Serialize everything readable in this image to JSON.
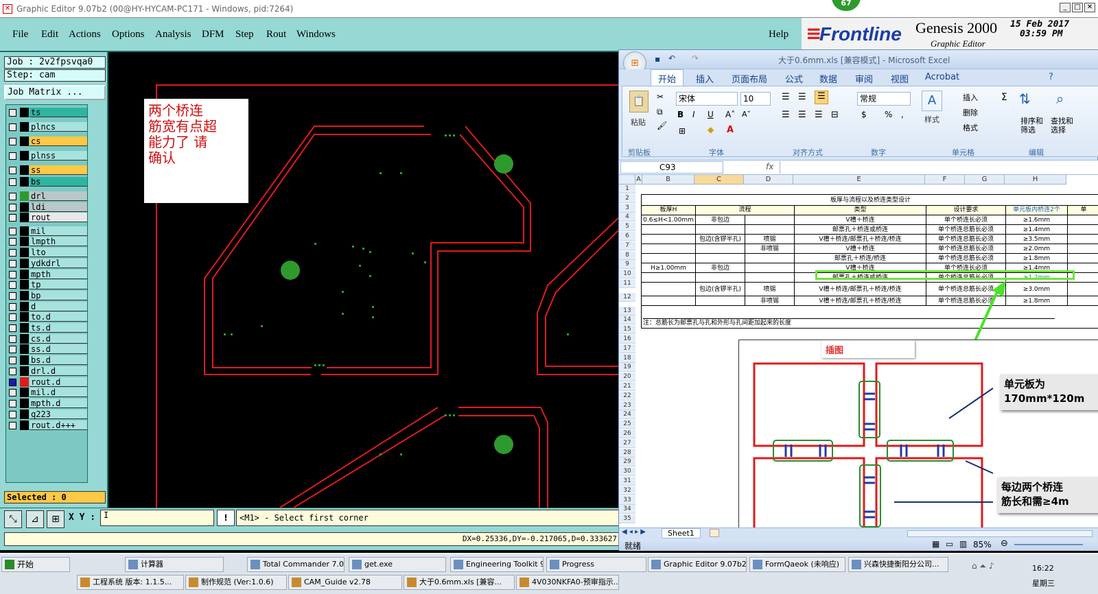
{
  "genesis": {
    "window_title": "Graphic Editor 9.07b2 (00@HY-HYCAM-PC171 - Windows, pid:7264)",
    "menu": [
      "File",
      "Edit",
      "Actions",
      "Options",
      "Analysis",
      "DFM",
      "Step",
      "Rout",
      "Windows"
    ],
    "help": "Help",
    "badge": "67",
    "brand": {
      "logo": "Frontline",
      "product": "Genesis 2000",
      "subtitle": "Graphic Editor",
      "date": "15 Feb 2017",
      "time": "03:59 PM"
    },
    "job_label": "Job : 2v2fpsvqa0",
    "step_label": "Step: cam",
    "job_matrix": "Job Matrix ...",
    "layers": [
      {
        "name": "ts",
        "color": "#2fb4a2"
      },
      {
        "name": "plncs",
        "color": "#a8e2de"
      },
      {
        "name": "cs",
        "color": "#ffc845"
      },
      {
        "name": "plnss",
        "color": "#a8e2de"
      },
      {
        "name": "ss",
        "color": "#ffc845"
      },
      {
        "name": "bs",
        "color": "#2fb4a2"
      },
      {
        "name": "drl",
        "color": "#b8c8c8"
      },
      {
        "name": "ldi",
        "color": "#b8c8c8"
      },
      {
        "name": "rout",
        "color": "#e8e8e8"
      },
      {
        "name": "mil",
        "color": "#a8e2de"
      },
      {
        "name": "lmpth",
        "color": "#a8e2de"
      },
      {
        "name": "lto",
        "color": "#a8e2de"
      },
      {
        "name": "ydkdrl",
        "color": "#a8e2de"
      },
      {
        "name": "mpth",
        "color": "#a8e2de"
      },
      {
        "name": "tp",
        "color": "#a8e2de"
      },
      {
        "name": "bp",
        "color": "#a8e2de"
      },
      {
        "name": "d",
        "color": "#a8e2de"
      },
      {
        "name": "to.d",
        "color": "#a8e2de"
      },
      {
        "name": "ts.d",
        "color": "#a8e2de"
      },
      {
        "name": "cs.d",
        "color": "#a8e2de"
      },
      {
        "name": "ss.d",
        "color": "#a8e2de"
      },
      {
        "name": "bs.d",
        "color": "#a8e2de"
      },
      {
        "name": "drl.d",
        "color": "#a8e2de"
      },
      {
        "name": "rout.d",
        "color": "#a8e2de"
      },
      {
        "name": "mil.d",
        "color": "#a8e2de"
      },
      {
        "name": "mpth.d",
        "color": "#a8e2de"
      },
      {
        "name": "q223",
        "color": "#a8e2de"
      },
      {
        "name": "rout.d+++",
        "color": "#a8e2de"
      }
    ],
    "selected": "Selected : 0",
    "xy_label": "X Y :",
    "prompt": "<M1> - Select first corner",
    "coords": "DX=0.25336,DY=-0.217065,D=0.333627",
    "note": [
      "两个桥连",
      "筋宽有点超",
      "能力了  请",
      "确认"
    ]
  },
  "excel": {
    "title": "大于0.6mm.xls [兼容模式] - Microsoft Excel",
    "tabs": [
      "开始",
      "插入",
      "页面布局",
      "公式",
      "数据",
      "审阅",
      "视图",
      "Acrobat"
    ],
    "ribbon": {
      "paste": "粘贴",
      "font_name": "宋体",
      "font_size": "10",
      "number_format": "常规",
      "styles": "样式",
      "insert": "插入",
      "delete": "删除",
      "format": "格式",
      "sort_filter": "排序和\n筛选",
      "find_select": "查找和\n选择",
      "groups": [
        "剪贴板",
        "字体",
        "对齐方式",
        "数字",
        "单元格",
        "编辑"
      ]
    },
    "name_box": "C93",
    "fx": "fx",
    "columns": [
      "A",
      "B",
      "C",
      "D",
      "E",
      "F",
      "G",
      "H"
    ],
    "table_title": "板厚与流程以及桥连类型设计",
    "headers": [
      "板厚H",
      "流程",
      "类型",
      "设计要求",
      "单元板内桥连2个",
      "单"
    ],
    "rows": [
      [
        "0.6≤H<1.00mm",
        "非包边",
        "",
        "V槽＋桥连",
        "单个桥连长必须",
        "≥1.6mm"
      ],
      [
        "",
        "",
        "",
        "邮票孔＋桥连或桥连",
        "单个桥连总筋长必须",
        "≥1.4mm"
      ],
      [
        "",
        "包边(含锣半孔)",
        "喷锡",
        "V槽＋桥连/邮票孔＋桥连/桥连",
        "单个桥连总筋长必须",
        "≥3.5mm"
      ],
      [
        "",
        "",
        "非喷锡",
        "V槽＋桥连",
        "单个桥连总筋长必须",
        "≥2.0mm"
      ],
      [
        "",
        "",
        "",
        "邮票孔＋桥连/桥连",
        "单个桥连总筋长必须",
        "≥1.8mm"
      ],
      [
        "H≥1.00mm",
        "非包边",
        "",
        "V槽＋桥连",
        "单个桥连长必须",
        "≥1.4mm"
      ],
      [
        "",
        "",
        "",
        "邮票孔＋桥连或桥连",
        "单个桥连总筋长必须",
        "≥1.2mm"
      ],
      [
        "",
        "包边(含锣半孔)",
        "喷锡",
        "V槽＋桥连/邮票孔＋桥连/桥连",
        "单个桥连总筋长必须",
        "≥3.0mm"
      ],
      [
        "",
        "",
        "非喷锡",
        "V槽＋桥连/邮票孔＋桥连/桥连",
        "单个桥连总筋长必须",
        "≥1.8mm"
      ]
    ],
    "footnote": "注：总筋长为邮票孔与孔和外形与孔间距加起来的长度",
    "insert_label": "插图",
    "callout1": "单元板为\n170mm*120m",
    "callout2": "每边两个桥连\n筋长和需≥4m",
    "sheet_tab": "Sheet1",
    "status": "就绪",
    "zoom": "85%"
  },
  "taskbar": {
    "start": "开始",
    "row1": [
      "计算器",
      "Total Commander 7.0 ...",
      "get.exe",
      "Engineering Toolkit 9....",
      "Progress",
      "Graphic Editor 9.07b2 ...",
      "FormQaeok (未响应)",
      "兴森快捷衡阳分公司..."
    ],
    "row2": [
      "工程系统  版本: 1.1.5...",
      "制作规范 (Ver:1.0.6)",
      "CAM_Guide v2.78",
      "大于0.6mm.xls [兼容...",
      "4V030NKFA0-预审指示..."
    ],
    "clock": "16:22",
    "day": "星期三"
  }
}
